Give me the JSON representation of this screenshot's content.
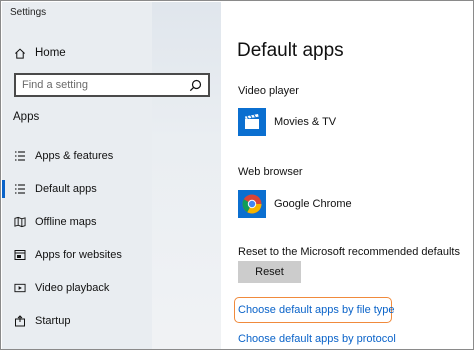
{
  "window": {
    "title": "Settings"
  },
  "sidebar": {
    "home_label": "Home",
    "search_placeholder": "Find a setting",
    "section_label": "Apps",
    "items": [
      {
        "label": "Apps & features",
        "icon": "list-icon"
      },
      {
        "label": "Default apps",
        "icon": "default-apps-icon",
        "active": true
      },
      {
        "label": "Offline maps",
        "icon": "map-icon"
      },
      {
        "label": "Apps for websites",
        "icon": "websites-icon"
      },
      {
        "label": "Video playback",
        "icon": "video-icon"
      },
      {
        "label": "Startup",
        "icon": "startup-icon"
      }
    ]
  },
  "main": {
    "title": "Default apps",
    "video_player": {
      "heading": "Video player",
      "app": "Movies & TV"
    },
    "web_browser": {
      "heading": "Web browser",
      "app": "Google Chrome"
    },
    "reset": {
      "text": "Reset to the Microsoft recommended defaults",
      "button": "Reset"
    },
    "links": {
      "by_file_type": "Choose default apps by file type",
      "by_protocol": "Choose default apps by protocol"
    }
  },
  "colors": {
    "accent": "#0a63c9",
    "highlight": "#f08a3c",
    "sidebar_bg": "#e9edf1",
    "button_bg": "#cccccc"
  }
}
